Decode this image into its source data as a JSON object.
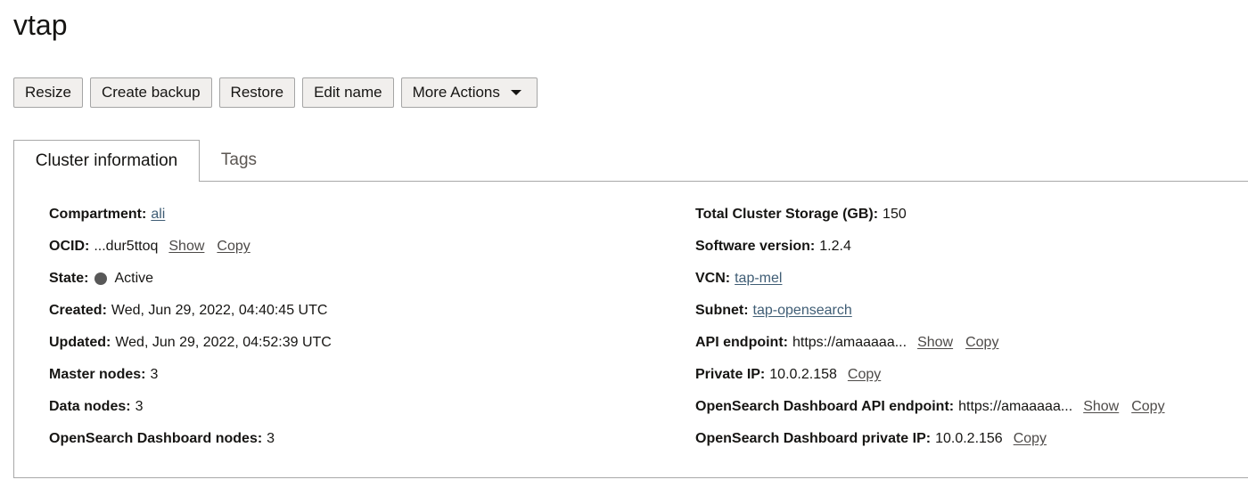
{
  "page": {
    "title": "vtap"
  },
  "toolbar": {
    "resize": "Resize",
    "create_backup": "Create backup",
    "restore": "Restore",
    "edit_name": "Edit name",
    "more_actions": "More Actions"
  },
  "tabs": {
    "cluster_information": "Cluster information",
    "tags": "Tags"
  },
  "left": {
    "compartment": {
      "label": "Compartment:",
      "value": "ali"
    },
    "ocid": {
      "label": "OCID:",
      "value": "...dur5ttoq",
      "show": "Show",
      "copy": "Copy"
    },
    "state": {
      "label": "State:",
      "value": "Active",
      "color": "#585858"
    },
    "created": {
      "label": "Created:",
      "value": "Wed, Jun 29, 2022, 04:40:45 UTC"
    },
    "updated": {
      "label": "Updated:",
      "value": "Wed, Jun 29, 2022, 04:52:39 UTC"
    },
    "master_nodes": {
      "label": "Master nodes:",
      "value": "3"
    },
    "data_nodes": {
      "label": "Data nodes:",
      "value": "3"
    },
    "dashboard_nodes": {
      "label": "OpenSearch Dashboard nodes:",
      "value": "3"
    }
  },
  "right": {
    "storage": {
      "label": "Total Cluster Storage (GB):",
      "value": "150"
    },
    "software_version": {
      "label": "Software version:",
      "value": "1.2.4"
    },
    "vcn": {
      "label": "VCN:",
      "value": "tap-mel"
    },
    "subnet": {
      "label": "Subnet:",
      "value": "tap-opensearch"
    },
    "api_endpoint": {
      "label": "API endpoint:",
      "value": "https://amaaaaa...",
      "show": "Show",
      "copy": "Copy"
    },
    "private_ip": {
      "label": "Private IP:",
      "value": "10.0.2.158",
      "copy": "Copy"
    },
    "dashboard_api_endpoint": {
      "label": "OpenSearch Dashboard API endpoint:",
      "value": "https://amaaaaa...",
      "show": "Show",
      "copy": "Copy"
    },
    "dashboard_private_ip": {
      "label": "OpenSearch Dashboard private IP:",
      "value": "10.0.2.156",
      "copy": "Copy"
    }
  }
}
